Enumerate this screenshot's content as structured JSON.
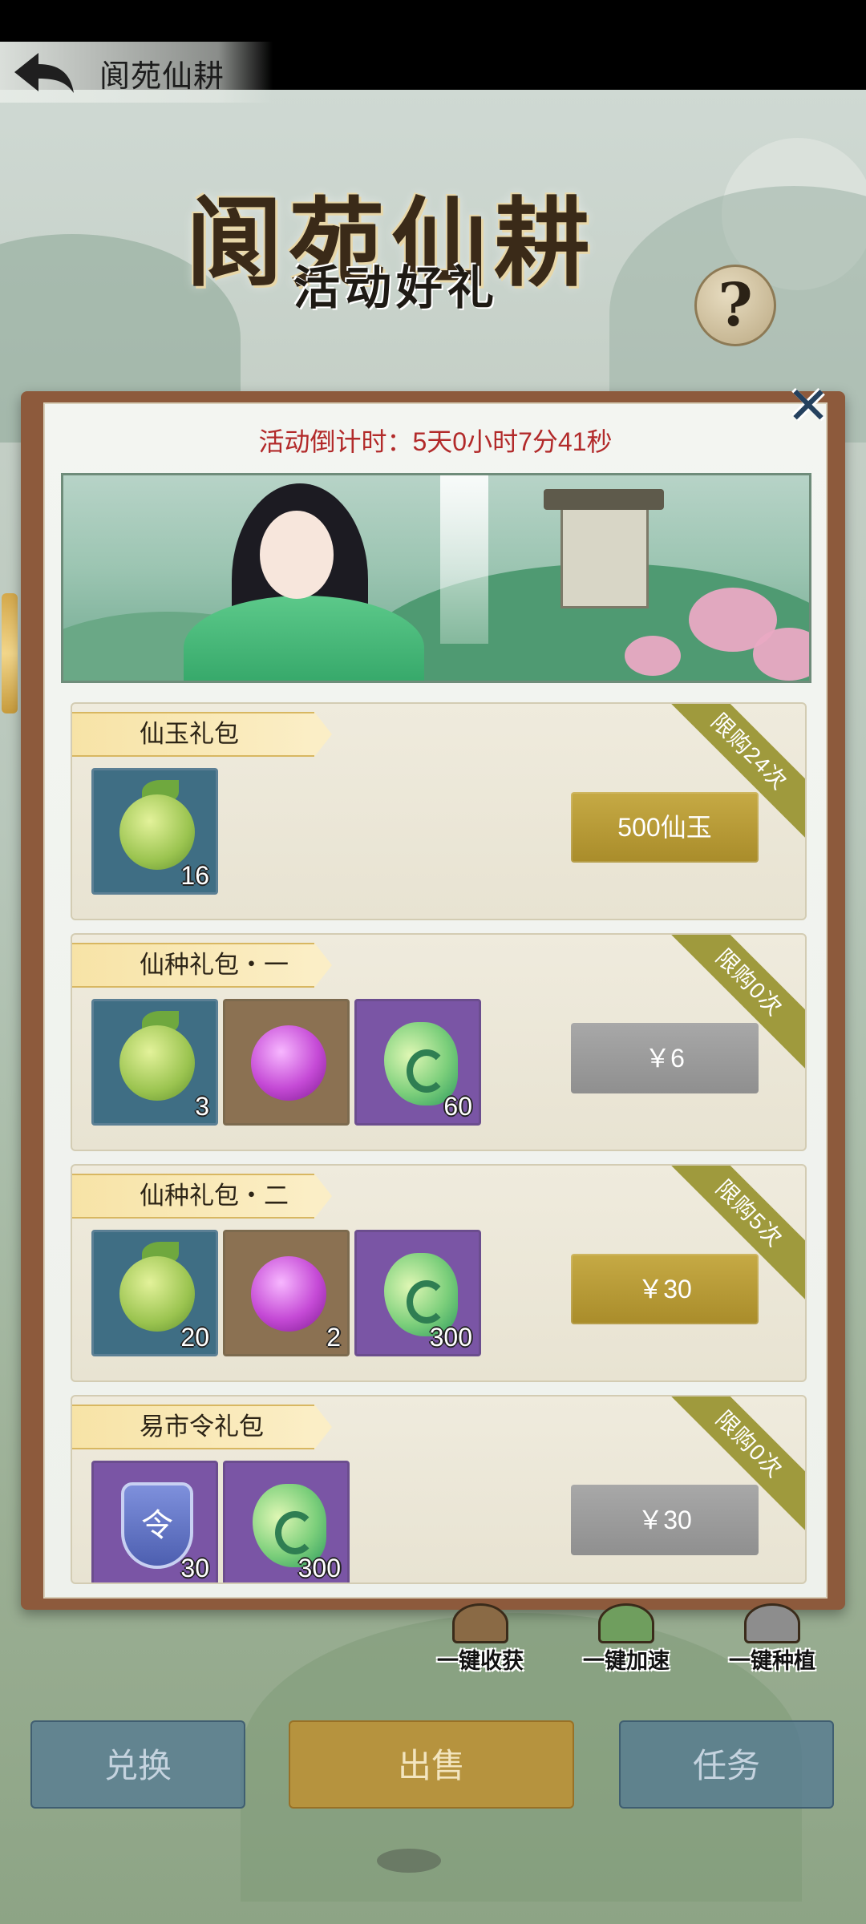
{
  "header": {
    "title": "阆苑仙耕",
    "big_title": "阆苑仙耕",
    "sub_title": "活动好礼",
    "help_symbol": "?",
    "close_symbol": "✕"
  },
  "countdown": "活动倒计时：5天0小时7分41秒",
  "packs": [
    {
      "name": "仙玉礼包",
      "limit": "限购24次",
      "items": [
        {
          "icon": "green-seed-icon",
          "count": "16"
        }
      ],
      "price": "500仙玉",
      "button_state": "active"
    },
    {
      "name": "仙种礼包・一",
      "limit": "限购0次",
      "items": [
        {
          "icon": "green-seed-icon",
          "count": "3"
        },
        {
          "icon": "purple-seed-icon",
          "count": ""
        },
        {
          "icon": "jade-icon",
          "count": "60"
        }
      ],
      "price": "￥6",
      "button_state": "disabled"
    },
    {
      "name": "仙种礼包・二",
      "limit": "限购5次",
      "items": [
        {
          "icon": "green-seed-icon",
          "count": "20"
        },
        {
          "icon": "purple-seed-icon",
          "count": "2"
        },
        {
          "icon": "jade-icon",
          "count": "300"
        }
      ],
      "price": "￥30",
      "button_state": "active"
    },
    {
      "name": "易市令礼包",
      "limit": "限购0次",
      "items": [
        {
          "icon": "market-token-icon",
          "count": "30"
        },
        {
          "icon": "jade-icon",
          "count": "300"
        }
      ],
      "price": "￥30",
      "button_state": "disabled"
    }
  ],
  "token_glyph": "令",
  "quick_actions": [
    "一键收获",
    "一键加速",
    "一键种植"
  ],
  "bottom_buttons": {
    "exchange": "兑换",
    "sell": "出售",
    "task": "任务"
  },
  "colors": {
    "countdown": "#b22a2a",
    "gold_button": "#b89a35",
    "gray_button": "#9a9a9a",
    "limit_tag": "#9f9a3d"
  }
}
